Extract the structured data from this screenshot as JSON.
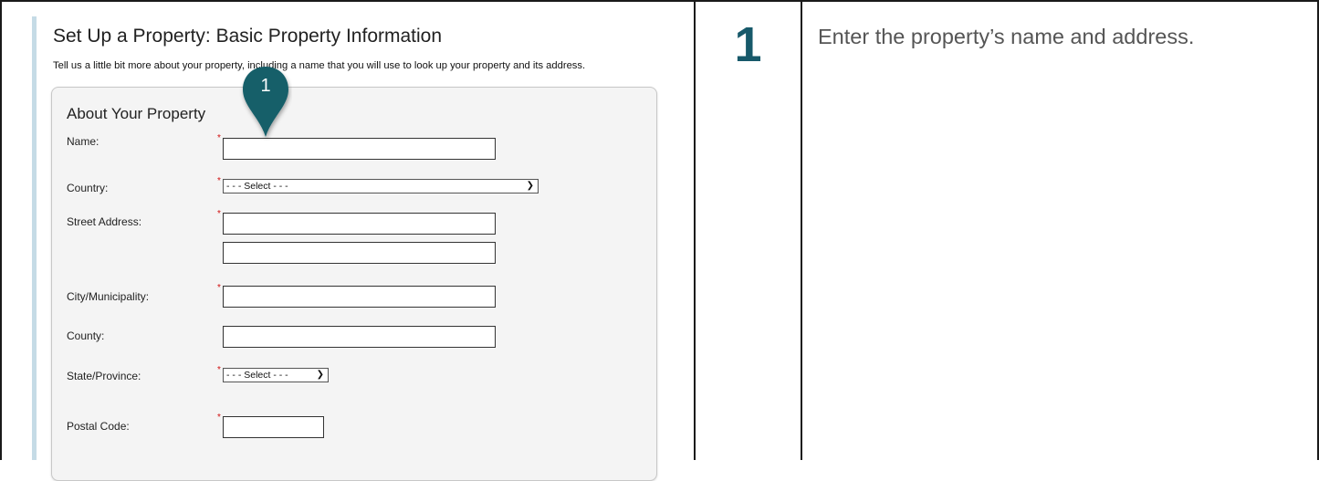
{
  "screenshot": {
    "title": "Set Up a Property: Basic Property Information",
    "subtitle": "Tell us a little bit more about your property, including a name that you will use to look up your property and its address.",
    "section_title": "About Your Property",
    "fields": {
      "name": {
        "label": "Name:",
        "required": "*"
      },
      "country": {
        "label": "Country:",
        "required": "*",
        "selected": "- - - Select - - -"
      },
      "street": {
        "label": "Street Address:",
        "required": "*"
      },
      "city": {
        "label": "City/Municipality:",
        "required": "*"
      },
      "county": {
        "label": "County:"
      },
      "state": {
        "label": "State/Province:",
        "required": "*",
        "selected": "- - - Select - - -"
      },
      "postal": {
        "label": "Postal Code:",
        "required": "*"
      }
    },
    "marker": {
      "number": "1",
      "color": "#155e69"
    }
  },
  "step": {
    "number": "1",
    "color": "#17596a"
  },
  "instruction": "Enter the property’s name and address."
}
